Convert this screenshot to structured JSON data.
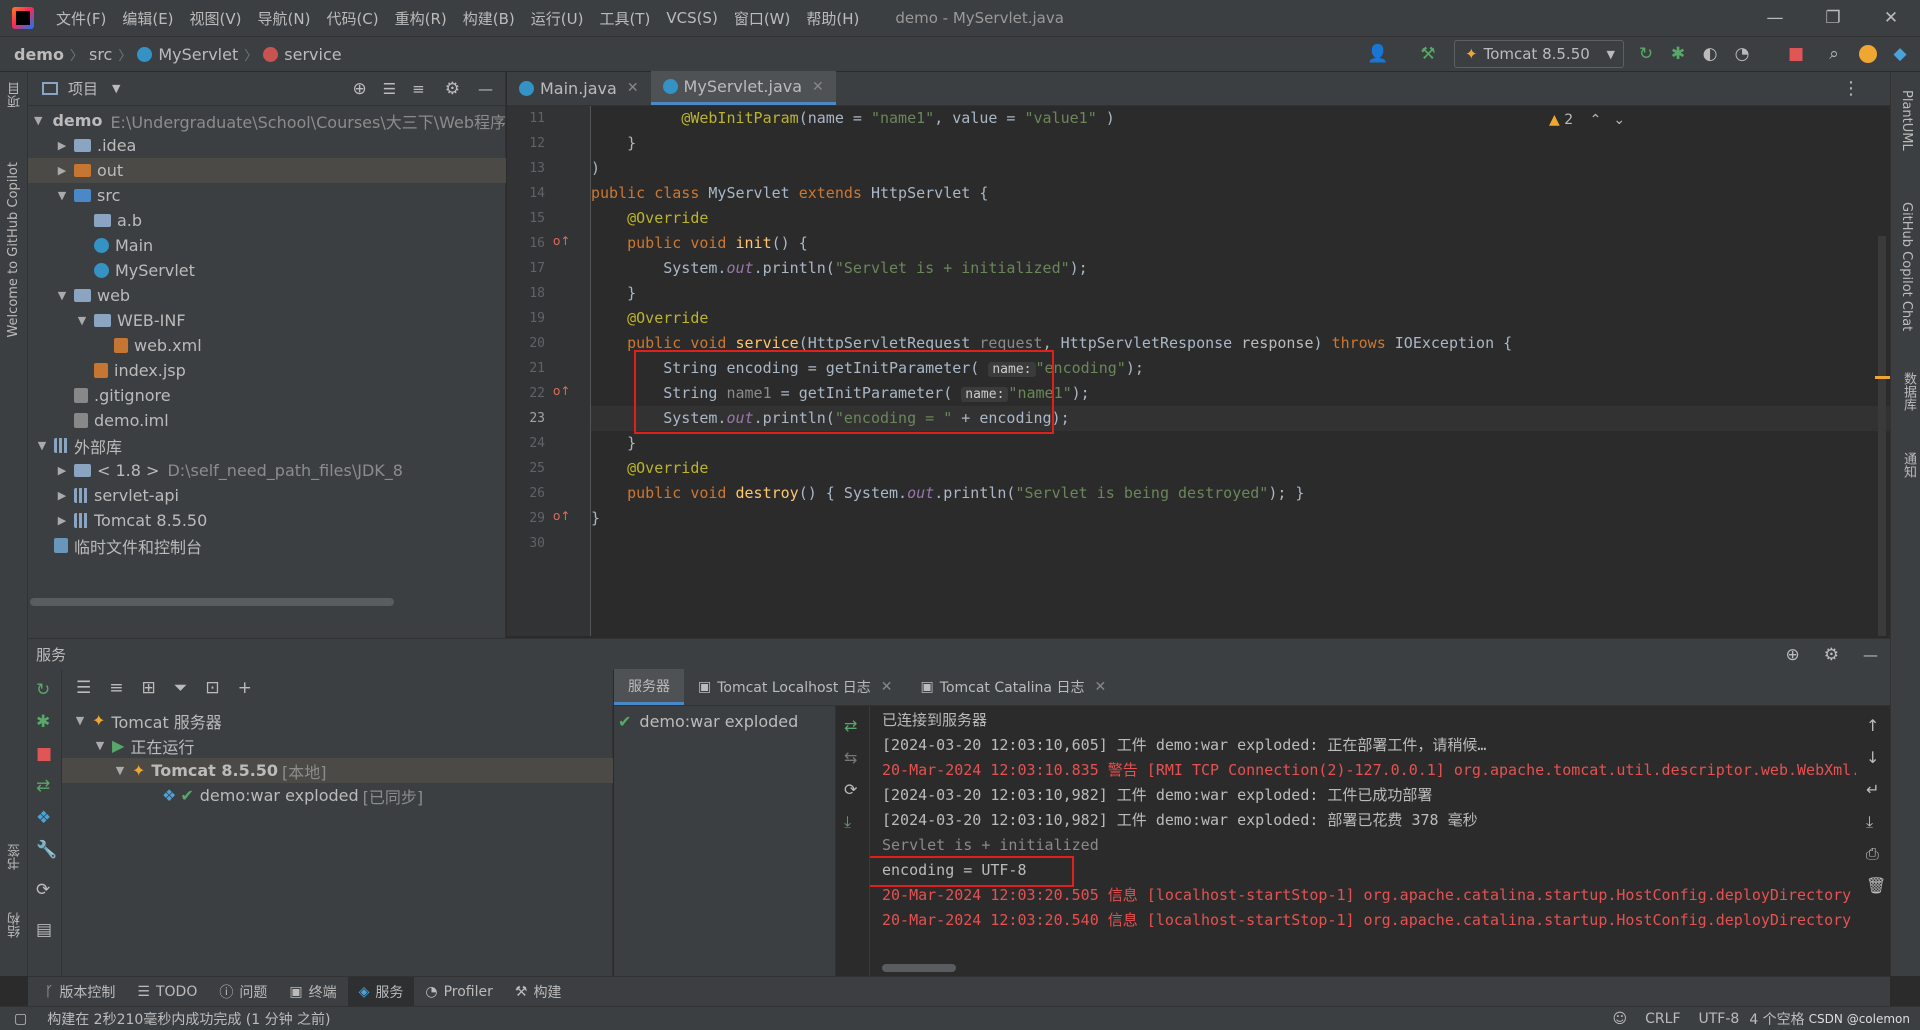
{
  "titlebar": {
    "menus": [
      "文件(F)",
      "编辑(E)",
      "视图(V)",
      "导航(N)",
      "代码(C)",
      "重构(R)",
      "构建(B)",
      "运行(U)",
      "工具(T)",
      "VCS(S)",
      "窗口(W)",
      "帮助(H)"
    ],
    "window_title": "demo - MyServlet.java",
    "minimize": "—",
    "restore": "❐",
    "close": "✕"
  },
  "navbar": {
    "crumbs": [
      "demo",
      "src",
      "MyServlet",
      "service"
    ],
    "run_config": "Tomcat 8.5.50"
  },
  "leftstrip": {
    "project": "项目",
    "copilot": "Welcome to GitHub Copilot",
    "bookmarks": "书签",
    "structure": "结构"
  },
  "rightstrip": {
    "plantuml": "PlantUML",
    "copilot_chat": "GitHub Copilot Chat",
    "database": "数据库",
    "notify": "通知"
  },
  "project": {
    "title": "项目",
    "tree": [
      {
        "label": "demo",
        "extra": "E:\\Undergraduate\\School\\Courses\\大三下\\Web程序"
      },
      {
        "label": ".idea",
        "extra": ""
      },
      {
        "label": "out",
        "extra": ""
      },
      {
        "label": "src",
        "extra": ""
      },
      {
        "label": "a.b",
        "extra": ""
      },
      {
        "label": "Main",
        "extra": ""
      },
      {
        "label": "MyServlet",
        "extra": ""
      },
      {
        "label": "web",
        "extra": ""
      },
      {
        "label": "WEB-INF",
        "extra": ""
      },
      {
        "label": "web.xml",
        "extra": ""
      },
      {
        "label": "index.jsp",
        "extra": ""
      },
      {
        "label": ".gitignore",
        "extra": ""
      },
      {
        "label": "demo.iml",
        "extra": ""
      },
      {
        "label": "外部库",
        "extra": ""
      },
      {
        "label": "< 1.8 >",
        "extra": "D:\\self_need_path_files\\JDK_8"
      },
      {
        "label": "servlet-api",
        "extra": ""
      },
      {
        "label": "Tomcat 8.5.50",
        "extra": ""
      },
      {
        "label": "临时文件和控制台",
        "extra": ""
      }
    ]
  },
  "editor": {
    "tabs": [
      "Main.java",
      "MyServlet.java"
    ],
    "warnings": "2",
    "line_numbers": [
      "11",
      "12",
      "13",
      "14",
      "15",
      "16",
      "17",
      "18",
      "19",
      "20",
      "21",
      "22",
      "23",
      "24",
      "25",
      "26",
      "29",
      "30"
    ],
    "hints": {
      "name": "name:"
    }
  },
  "services": {
    "title": "服务",
    "tree": [
      "Tomcat 服务器",
      "正在运行",
      "Tomcat 8.5.50",
      "[本地]",
      "demo:war exploded",
      "[已同步]"
    ],
    "deploy_item": "demo:war exploded",
    "tabs": [
      "服务器",
      "Tomcat Localhost 日志",
      "Tomcat Catalina 日志"
    ],
    "console": [
      {
        "text": "已连接到服务器",
        "style": "normal"
      },
      {
        "text": "[2024-03-20 12:03:10,605] 工件 demo:war exploded: 正在部署工件，请稍候…",
        "style": "normal"
      },
      {
        "text": "20-Mar-2024 12:03:10.835 警告 [RMI TCP Connection(2)-127.0.0.1] org.apache.tomcat.util.descriptor.web.WebXml.",
        "style": "red"
      },
      {
        "text": "[2024-03-20 12:03:10,982] 工件 demo:war exploded: 工件已成功部署",
        "style": "normal"
      },
      {
        "text": "[2024-03-20 12:03:10,982] 工件 demo:war exploded: 部署已花费 378 毫秒",
        "style": "normal"
      },
      {
        "text": "Servlet is + initialized",
        "style": "dim"
      },
      {
        "text": "encoding = UTF-8",
        "style": "normal"
      },
      {
        "text": "20-Mar-2024 12:03:20.505 信息 [localhost-startStop-1] org.apache.catalina.startup.HostConfig.deployDirectory",
        "style": "red"
      },
      {
        "text": "20-Mar-2024 12:03:20.540 信息 [localhost-startStop-1] org.apache.catalina.startup.HostConfig.deployDirectory",
        "style": "red"
      }
    ]
  },
  "toolstrip": [
    "版本控制",
    "TODO",
    "问题",
    "终端",
    "服务",
    "Profiler",
    "构建"
  ],
  "status": {
    "message": "构建在 2秒210毫秒内成功完成 (1 分钟 之前)",
    "line_sep": "CRLF",
    "encoding": "UTF-8",
    "indent": "4 个空格",
    "watermark": "CSDN @colemon"
  },
  "colors": {
    "accent": "#4a88c7",
    "highlight_box": "#e0201b",
    "error_text": "#e65151"
  }
}
